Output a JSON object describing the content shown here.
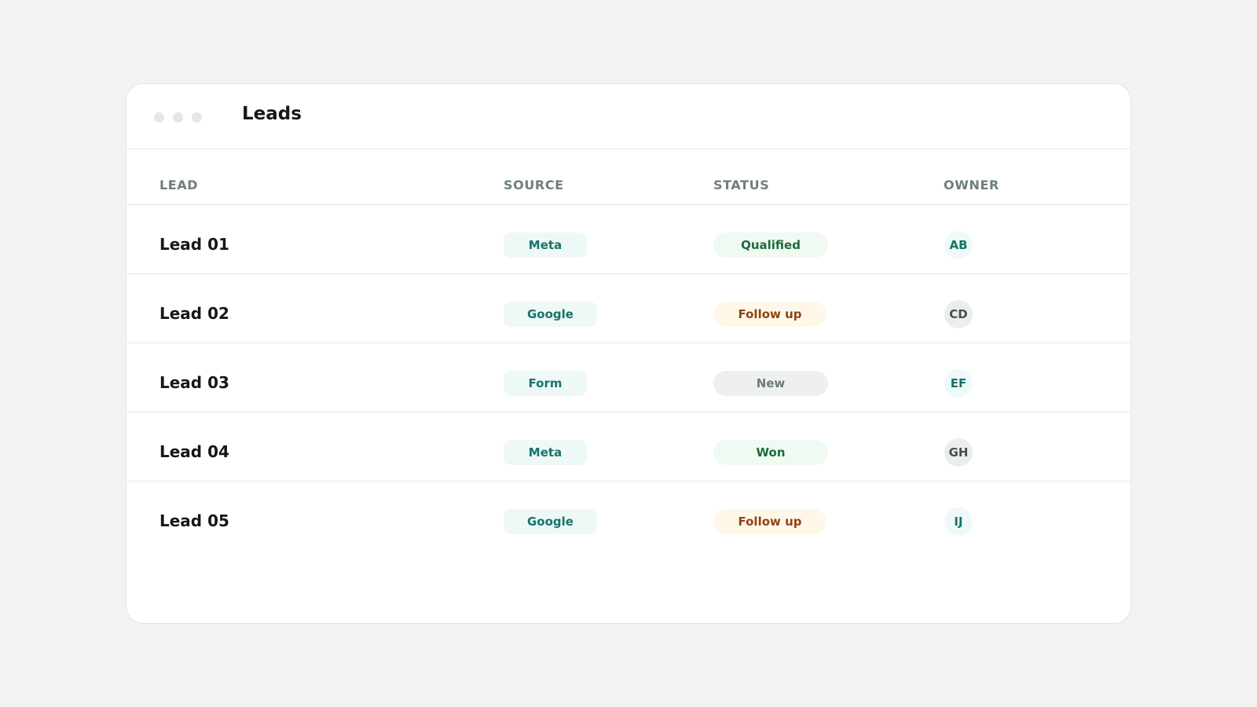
{
  "window": {
    "title": "Leads"
  },
  "table": {
    "columns": [
      "LEAD",
      "SOURCE",
      "STATUS",
      "OWNER"
    ],
    "rows": [
      {
        "lead": "Lead 01",
        "source": "Meta",
        "status": "Qualified",
        "owner": "AB"
      },
      {
        "lead": "Lead 02",
        "source": "Google",
        "status": "Follow up",
        "owner": "CD"
      },
      {
        "lead": "Lead 03",
        "source": "Form",
        "status": "New",
        "owner": "EF"
      },
      {
        "lead": "Lead 04",
        "source": "Meta",
        "status": "Won",
        "owner": "GH"
      },
      {
        "lead": "Lead 05",
        "source": "Google",
        "status": "Follow up",
        "owner": "IJ"
      }
    ]
  },
  "colors": {
    "source_bg": "#eef9f7",
    "source_text": "#17736a",
    "qualified_text": "#1e6a3d",
    "follow_up_text": "#8f4414",
    "new_text": "#6e7a77"
  }
}
